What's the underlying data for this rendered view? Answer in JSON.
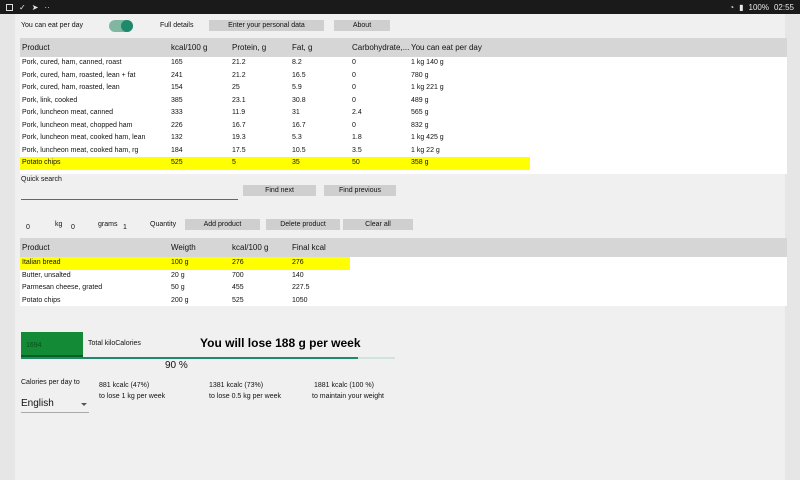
{
  "status_bar": {
    "battery": "100%",
    "time": "02:55",
    "icons": [
      "gallery-icon",
      "vine-icon",
      "send-icon",
      "more-icon",
      "wifi-icon",
      "battery-icon"
    ]
  },
  "top": {
    "toggle_label": "You can eat per day",
    "toggle_on": true,
    "full_details": "Full details",
    "personal_data_button": "Enter your personal data",
    "about_button": "About"
  },
  "food_table": {
    "headers": [
      "Product",
      "kcal/100 g",
      "Protein, g",
      "Fat, g",
      "Carbohydrate,...",
      "You can eat per day"
    ],
    "rows": [
      [
        "Pork, cured, ham, canned, roast",
        "165",
        "21.2",
        "8.2",
        "0",
        "1 kg 140 g"
      ],
      [
        "Pork, cured, ham, roasted, lean + fat",
        "241",
        "21.2",
        "16.5",
        "0",
        "780 g"
      ],
      [
        "Pork, cured, ham, roasted, lean",
        "154",
        "25",
        "5.9",
        "0",
        "1 kg 221 g"
      ],
      [
        "Pork, link, cooked",
        "385",
        "23.1",
        "30.8",
        "0",
        "489 g"
      ],
      [
        "Pork, luncheon meat, canned",
        "333",
        "11.9",
        "31",
        "2.4",
        "565 g"
      ],
      [
        "Pork, luncheon meat, chopped ham",
        "226",
        "16.7",
        "16.7",
        "0",
        "832 g"
      ],
      [
        "Pork, luncheon meat, cooked ham, lean",
        "132",
        "19.3",
        "5.3",
        "1.8",
        "1 kg 425 g"
      ],
      [
        "Pork, luncheon meat, cooked ham, rg",
        "184",
        "17.5",
        "10.5",
        "3.5",
        "1 kg 22 g"
      ],
      [
        "Potato chips",
        "525",
        "5",
        "35",
        "50",
        "358 g"
      ]
    ],
    "selected_row": 8
  },
  "search": {
    "label": "Quick search",
    "value": "",
    "find_next": "Find next",
    "find_previous": "Find previous"
  },
  "entry": {
    "kg_value": "0",
    "kg_label": "kg",
    "grams_value": "0",
    "grams_label": "grams",
    "quantity_value": "1",
    "quantity_label": "Quantity",
    "add_button": "Add product",
    "delete_button": "Delete product",
    "clear_button": "Clear all"
  },
  "selected_table": {
    "headers": [
      "Product",
      "Weigth",
      "kcal/100 g",
      "Final kcal"
    ],
    "rows": [
      [
        "Italian bread",
        "100 g",
        "276",
        "276"
      ],
      [
        "Butter, unsalted",
        "20 g",
        "700",
        "140"
      ],
      [
        "Parmesan cheese, grated",
        "50 g",
        "455",
        "227.5"
      ],
      [
        "Potato chips",
        "200 g",
        "525",
        "1050"
      ]
    ],
    "selected_row": 0
  },
  "summary": {
    "total_value": "1694",
    "total_label": "Total kiloCalories",
    "headline": "You will lose 188 g per week",
    "progress_percent": 90,
    "progress_label": "90 %",
    "calories_label": "Calories per day to",
    "goals": [
      {
        "kcal": "881 kcalc (47%)",
        "desc": "to lose 1 kg per week"
      },
      {
        "kcal": "1381 kcalc (73%)",
        "desc": "to lose 0.5 kg per week"
      },
      {
        "kcal": "1881 kcalc (100 %)",
        "desc": "to maintain your weight"
      }
    ],
    "language": "English"
  },
  "colors": {
    "accent": "#1e8a6b",
    "highlight": "#ffff00",
    "total_box": "#138a36"
  }
}
